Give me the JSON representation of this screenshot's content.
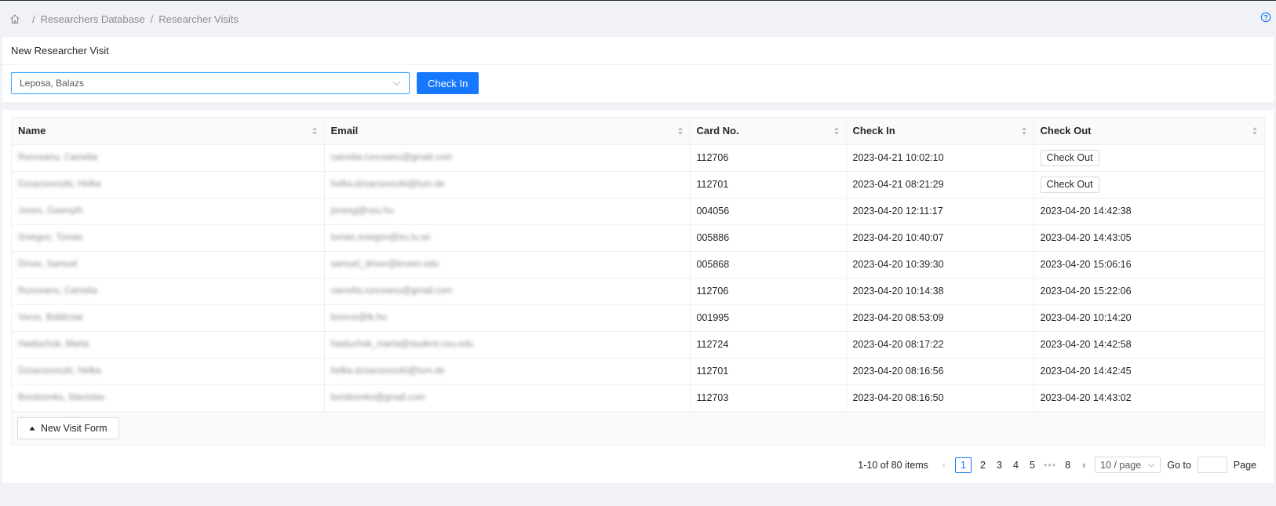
{
  "breadcrumb": {
    "items": [
      "Researchers Database",
      "Researcher Visits"
    ],
    "separator": "/"
  },
  "form": {
    "title": "New Researcher Visit",
    "select_value": "Leposa, Balazs",
    "check_in_label": "Check In"
  },
  "table": {
    "columns": [
      "Name",
      "Email",
      "Card No.",
      "Check In",
      "Check Out"
    ],
    "checkout_label": "Check Out",
    "rows": [
      {
        "name": "Runceanu, Camelia",
        "email": "camelia.runceanu@gmail.com",
        "card": "112706",
        "check_in": "2023-04-21 10:02:10",
        "check_out": ""
      },
      {
        "name": "Dzsacsovszki, Helka",
        "email": "helka.dzsacsovszki@tum.de",
        "card": "112701",
        "check_in": "2023-04-21 08:21:29",
        "check_out": ""
      },
      {
        "name": "Jones, Gwenyth",
        "email": "jonesg@ceu.hu",
        "card": "004056",
        "check_in": "2023-04-20 12:11:17",
        "check_out": "2023-04-20 14:42:38"
      },
      {
        "name": "Sniegon, Tomas",
        "email": "tomas.sniegon@eu.lu.se",
        "card": "005886",
        "check_in": "2023-04-20 10:40:07",
        "check_out": "2023-04-20 14:43:05"
      },
      {
        "name": "Driver, Samuel",
        "email": "samuel_driver@brown.edu",
        "card": "005868",
        "check_in": "2023-04-20 10:39:30",
        "check_out": "2023-04-20 15:06:16"
      },
      {
        "name": "Runceanu, Camelia",
        "email": "camelia.runceanu@gmail.com",
        "card": "112706",
        "check_in": "2023-04-20 10:14:38",
        "check_out": "2023-04-20 15:22:06"
      },
      {
        "name": "Voros, Boldizsar",
        "email": "bvoros@tk.hu",
        "card": "001995",
        "check_in": "2023-04-20 08:53:09",
        "check_out": "2023-04-20 10:14:20"
      },
      {
        "name": "Haiduchok, Marta",
        "email": "haiduchok_marta@student.ceu.edu",
        "card": "112724",
        "check_in": "2023-04-20 08:17:22",
        "check_out": "2023-04-20 14:42:58"
      },
      {
        "name": "Dzsacsovszki, Helka",
        "email": "helka.dzsacsovszki@tum.de",
        "card": "112701",
        "check_in": "2023-04-20 08:16:56",
        "check_out": "2023-04-20 14:42:45"
      },
      {
        "name": "Boridzenko, Stanislav",
        "email": "boridzenko@gmail.com",
        "card": "112703",
        "check_in": "2023-04-20 08:16:50",
        "check_out": "2023-04-20 14:43:02"
      }
    ],
    "footer_button": "New Visit Form"
  },
  "pagination": {
    "total": "1-10 of 80 items",
    "pages": [
      "1",
      "2",
      "3",
      "4",
      "5"
    ],
    "last_page": "8",
    "current": "1",
    "page_size": "10 / page",
    "goto_label": "Go to",
    "page_label": "Page"
  }
}
